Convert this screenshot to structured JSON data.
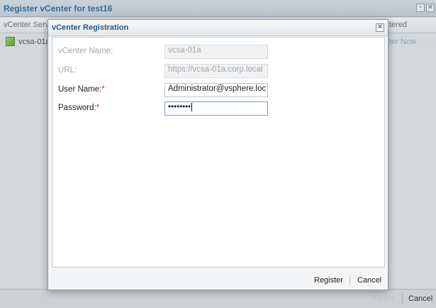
{
  "outer_window": {
    "title": "Register vCenter for test16",
    "columns": [
      "vCenter Serv",
      "tered"
    ],
    "row": {
      "name": "vcsa-01a",
      "action": "ter Now"
    },
    "footer": {
      "finish_label": "Finish",
      "cancel_label": "Cancel"
    }
  },
  "dialog": {
    "title": "vCenter Registration",
    "fields": [
      {
        "label": "vCenter Name:",
        "value": "vcsa-01a",
        "required": false,
        "disabled": true
      },
      {
        "label": "URL:",
        "value": "https://vcsa-01a.corp.local",
        "required": false,
        "disabled": true
      },
      {
        "label": "User Name:",
        "value": "Administrator@vsphere.loc",
        "required": true,
        "disabled": false
      },
      {
        "label": "Password:",
        "value": "••••••••",
        "required": true,
        "disabled": false
      }
    ],
    "required_marker": "*",
    "buttons": {
      "register_label": "Register",
      "cancel_label": "Cancel"
    }
  },
  "colors": {
    "title_blue": "#2c5a85",
    "required_red": "#d4302b"
  }
}
